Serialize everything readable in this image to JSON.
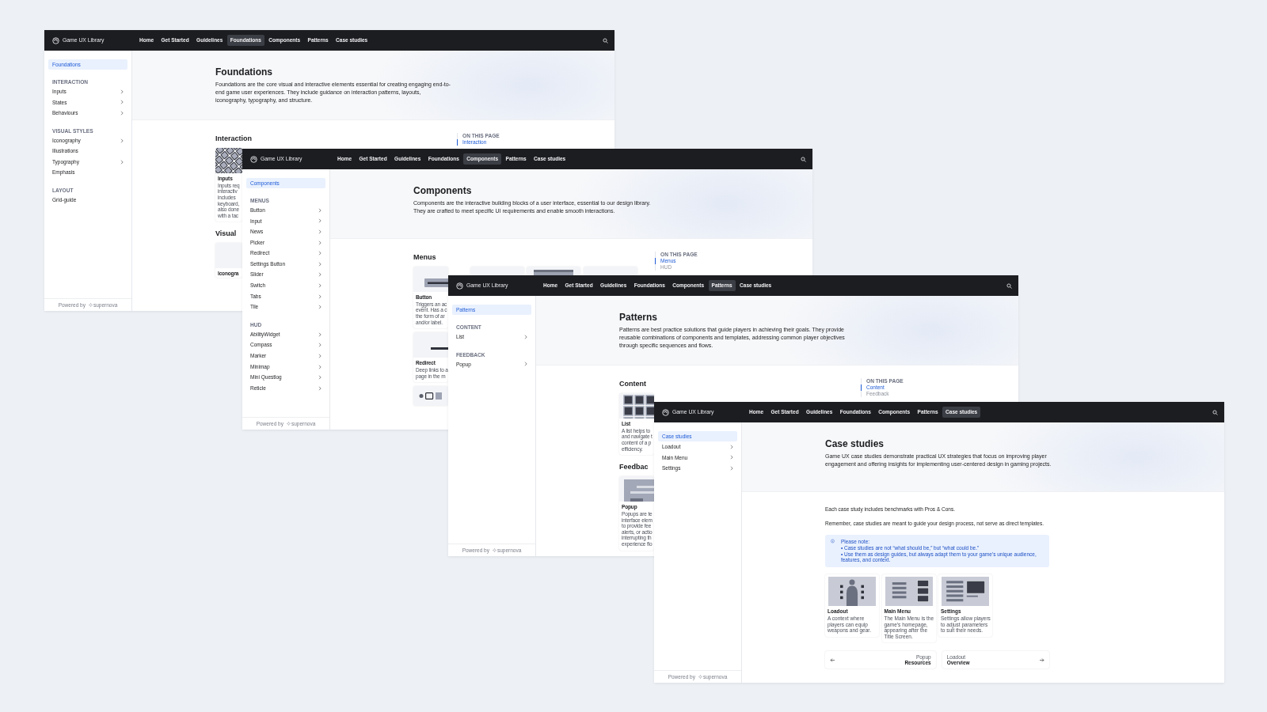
{
  "windows": [
    {
      "nav": {
        "brand": "Game UX Library",
        "items": [
          {
            "label": "Home",
            "selected": false
          },
          {
            "label": "Get Started",
            "selected": false
          },
          {
            "label": "Guidelines",
            "selected": false
          },
          {
            "label": "Foundations",
            "selected": true
          },
          {
            "label": "Components",
            "selected": false
          },
          {
            "label": "Patterns",
            "selected": false
          },
          {
            "label": "Case studies",
            "selected": false
          }
        ]
      },
      "sidebar": {
        "groups": [
          {
            "items": [
              {
                "label": "Foundations",
                "selected": true,
                "expandable": false
              }
            ]
          },
          {
            "title": "INTERACTION",
            "items": [
              {
                "label": "Inputs",
                "selected": false,
                "expandable": true
              },
              {
                "label": "States",
                "selected": false,
                "expandable": true
              },
              {
                "label": "Behaviours",
                "selected": false,
                "expandable": true
              }
            ]
          },
          {
            "title": "VISUAL STYLES",
            "items": [
              {
                "label": "Iconography",
                "selected": false,
                "expandable": true
              },
              {
                "label": "Illustrations",
                "selected": false,
                "expandable": false
              },
              {
                "label": "Typography",
                "selected": false,
                "expandable": true
              },
              {
                "label": "Emphasis",
                "selected": false,
                "expandable": false
              }
            ]
          },
          {
            "title": "LAYOUT",
            "items": [
              {
                "label": "Grid-guide",
                "selected": false,
                "expandable": false
              }
            ]
          }
        ],
        "footer": {
          "text": "Powered by",
          "brand": "supernova"
        }
      },
      "header": {
        "title": "Foundations",
        "description": "Foundations are the core visual and interactive elements essential for creating engaging end-to-end game user experiences. They include guidance on interaction patterns, layouts, iconography, typography, and structure."
      },
      "on_this_page": {
        "title": "ON THIS PAGE",
        "links": [
          {
            "label": "Interaction",
            "selected": true
          }
        ]
      },
      "blocks": [
        {
          "kind": "heading",
          "text": "Interaction"
        },
        {
          "kind": "card_row",
          "cards": [
            {
              "kind": "keyboard",
              "title": "Inputs",
              "description_lines": [
                "Inputs req",
                "interactiv",
                "includes",
                "keyboard,",
                "also done",
                "with a tac"
              ]
            }
          ]
        },
        {
          "kind": "heading",
          "text": "Visual"
        },
        {
          "kind": "card_row",
          "cards": [
            {
              "kind": "blank",
              "title": "Iconogra"
            }
          ]
        }
      ]
    },
    {
      "nav": {
        "brand": "Game UX Library",
        "items": [
          {
            "label": "Home",
            "selected": false
          },
          {
            "label": "Get Started",
            "selected": false
          },
          {
            "label": "Guidelines",
            "selected": false
          },
          {
            "label": "Foundations",
            "selected": false
          },
          {
            "label": "Components",
            "selected": true
          },
          {
            "label": "Patterns",
            "selected": false
          },
          {
            "label": "Case studies",
            "selected": false
          }
        ]
      },
      "sidebar": {
        "groups": [
          {
            "items": [
              {
                "label": "Components",
                "selected": true,
                "expandable": false
              }
            ]
          },
          {
            "title": "MENUS",
            "items": [
              {
                "label": "Button",
                "selected": false,
                "expandable": true
              },
              {
                "label": "Input",
                "selected": false,
                "expandable": true
              },
              {
                "label": "News",
                "selected": false,
                "expandable": true
              },
              {
                "label": "Picker",
                "selected": false,
                "expandable": true
              },
              {
                "label": "Redirect",
                "selected": false,
                "expandable": true
              },
              {
                "label": "Settings Button",
                "selected": false,
                "expandable": true
              },
              {
                "label": "Slider",
                "selected": false,
                "expandable": true
              },
              {
                "label": "Switch",
                "selected": false,
                "expandable": true
              },
              {
                "label": "Tabs",
                "selected": false,
                "expandable": true
              },
              {
                "label": "Tile",
                "selected": false,
                "expandable": true
              }
            ]
          },
          {
            "title": "HUD",
            "items": [
              {
                "label": "AbilityWidget",
                "selected": false,
                "expandable": true
              },
              {
                "label": "Compass",
                "selected": false,
                "expandable": true
              },
              {
                "label": "Marker",
                "selected": false,
                "expandable": true
              },
              {
                "label": "Minimap",
                "selected": false,
                "expandable": true
              },
              {
                "label": "Mini Questlog",
                "selected": false,
                "expandable": true
              },
              {
                "label": "Reticle",
                "selected": false,
                "expandable": true
              }
            ]
          }
        ],
        "footer": {
          "text": "Powered by",
          "brand": "supernova"
        }
      },
      "header": {
        "title": "Components",
        "description": "Components are the interactive building blocks of a user interface, essential to our design library. They are crafted to meet specific UI requirements and enable smooth interactions."
      },
      "on_this_page": {
        "title": "ON THIS PAGE",
        "links": [
          {
            "label": "Menus",
            "selected": true
          },
          {
            "label": "HUD",
            "selected": false
          }
        ]
      },
      "blocks": [
        {
          "kind": "heading",
          "text": "Menus"
        },
        {
          "kind": "card_row",
          "cards": [
            {
              "kind": "button",
              "title": "Button",
              "description_lines": [
                "Triggers an ac",
                "event. Has a c",
                "the form of ar",
                "and/or label."
              ]
            },
            {
              "kind": "blank"
            },
            {
              "kind": "panel"
            },
            {
              "kind": "blank"
            }
          ]
        },
        {
          "kind": "card_row",
          "cards": [
            {
              "kind": "dash",
              "title": "Redirect",
              "description_lines": [
                "Deep links to a",
                "page in the m"
              ]
            }
          ]
        },
        {
          "kind": "card_row",
          "cards": [
            {
              "kind": "icons"
            }
          ]
        }
      ]
    },
    {
      "nav": {
        "brand": "Game UX Library",
        "items": [
          {
            "label": "Home",
            "selected": false
          },
          {
            "label": "Get Started",
            "selected": false
          },
          {
            "label": "Guidelines",
            "selected": false
          },
          {
            "label": "Foundations",
            "selected": false
          },
          {
            "label": "Components",
            "selected": false
          },
          {
            "label": "Patterns",
            "selected": true
          },
          {
            "label": "Case studies",
            "selected": false
          }
        ]
      },
      "sidebar": {
        "groups": [
          {
            "items": [
              {
                "label": "Patterns",
                "selected": true,
                "expandable": false
              }
            ]
          },
          {
            "title": "CONTENT",
            "items": [
              {
                "label": "List",
                "selected": false,
                "expandable": true
              }
            ]
          },
          {
            "title": "FEEDBACK",
            "items": [
              {
                "label": "Popup",
                "selected": false,
                "expandable": true
              }
            ]
          }
        ],
        "footer": {
          "text": "Powered by",
          "brand": "supernova"
        }
      },
      "header": {
        "title": "Patterns",
        "description": "Patterns are best practice solutions that guide players in achieving their goals. They provide reusable combinations of components and templates, addressing common player objectives through specific sequences and flows."
      },
      "on_this_page": {
        "title": "ON THIS PAGE",
        "links": [
          {
            "label": "Content",
            "selected": true
          },
          {
            "label": "Feedback",
            "selected": false
          }
        ]
      },
      "blocks": [
        {
          "kind": "heading",
          "text": "Content"
        },
        {
          "kind": "card_row",
          "cards": [
            {
              "kind": "grid",
              "title": "List",
              "description_lines": [
                "A list helps to",
                "and navigate t",
                "content of a p",
                "efficiency."
              ]
            }
          ]
        },
        {
          "kind": "heading",
          "text": "Feedbac"
        },
        {
          "kind": "card_row",
          "cards": [
            {
              "kind": "popup",
              "title": "Popup",
              "description_lines": [
                "Popups are te",
                "interface elem",
                "to provide fee",
                "alerts, or actio",
                "interrupting th",
                "experience flo"
              ]
            }
          ]
        }
      ]
    },
    {
      "nav": {
        "brand": "Game UX Library",
        "items": [
          {
            "label": "Home",
            "selected": false
          },
          {
            "label": "Get Started",
            "selected": false
          },
          {
            "label": "Guidelines",
            "selected": false
          },
          {
            "label": "Foundations",
            "selected": false
          },
          {
            "label": "Components",
            "selected": false
          },
          {
            "label": "Patterns",
            "selected": false
          },
          {
            "label": "Case studies",
            "selected": true
          }
        ]
      },
      "sidebar": {
        "groups": [
          {
            "items": [
              {
                "label": "Case studies",
                "selected": true,
                "expandable": false
              }
            ]
          },
          {
            "items": [
              {
                "label": "Loadout",
                "selected": false,
                "expandable": true
              },
              {
                "label": "Main Menu",
                "selected": false,
                "expandable": true
              },
              {
                "label": "Settings",
                "selected": false,
                "expandable": true
              }
            ]
          }
        ],
        "footer": {
          "text": "Powered by",
          "brand": "supernova"
        }
      },
      "header": {
        "title": "Case studies",
        "description": "Game UX case studies demonstrate practical UX strategies that focus on improving player engagement and offering insights for implementing user-centered design in gaming projects."
      },
      "blocks": [
        {
          "kind": "paragraph",
          "text": "Each case study includes benchmarks with Pros & Cons."
        },
        {
          "kind": "paragraph",
          "text": "Remember, case studies are meant to guide your design process, not serve as direct templates."
        },
        {
          "kind": "note",
          "title": "Please note:",
          "bullets": [
            "• Case studies are not “what should be,” but “what could be.”",
            "• Use them as design guides, but always adapt them to your game’s unique audience, features, and context."
          ]
        },
        {
          "kind": "card_row",
          "cards": [
            {
              "kind": "loadout",
              "title": "Loadout",
              "description": "A context where players can equip weapons and gear."
            },
            {
              "kind": "mainmenu",
              "title": "Main Menu",
              "description": "The Main Menu is the game’s homepage, appearing after the Title Screen."
            },
            {
              "kind": "settings",
              "title": "Settings",
              "description": "Settings allow players to adjust parameters to suit their needs."
            }
          ]
        },
        {
          "kind": "pager",
          "previous": {
            "label": "Popup",
            "title": "Resources"
          },
          "next": {
            "label": "Loadout",
            "title": "Overview"
          }
        }
      ]
    }
  ]
}
